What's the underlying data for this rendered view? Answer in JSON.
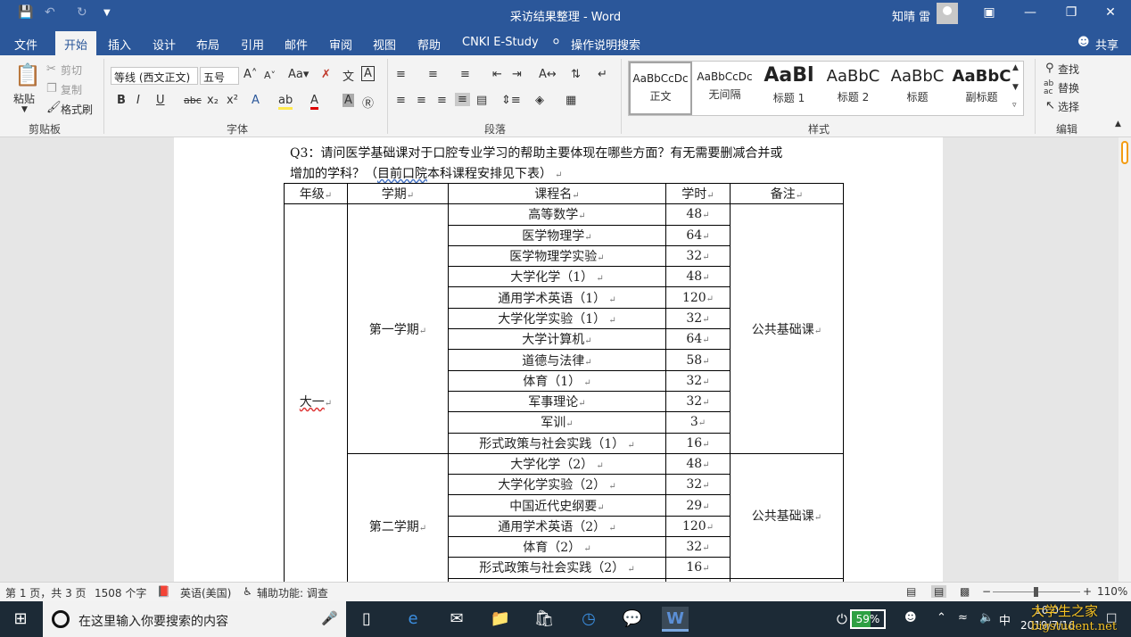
{
  "titlebar": {
    "title": "采访结果整理  -  Word",
    "user": "知晴 雷",
    "save_icon": "save-icon",
    "undo_icon": "undo-icon",
    "redo_icon": "redo-icon",
    "customize_icon": "customize-icon"
  },
  "tabs": [
    "文件",
    "开始",
    "插入",
    "设计",
    "布局",
    "引用",
    "邮件",
    "审阅",
    "视图",
    "帮助",
    "CNKI E-Study"
  ],
  "tell_me": "操作说明搜索",
  "share": "共享",
  "ribbon": {
    "clipboard": {
      "paste": "粘贴",
      "cut": "剪切",
      "copy": "复制",
      "format_painter": "格式刷",
      "label": "剪贴板"
    },
    "font": {
      "font_name": "等线 (西文正文)",
      "font_size": "五号",
      "label": "字体"
    },
    "paragraph": {
      "label": "段落"
    },
    "styles": {
      "label": "样式",
      "items": [
        {
          "preview": "AaBbCcDc",
          "name": "正文"
        },
        {
          "preview": "AaBbCcDc",
          "name": "无间隔"
        },
        {
          "preview": "AaBl",
          "name": "标题 1"
        },
        {
          "preview": "AaBbC",
          "name": "标题 2"
        },
        {
          "preview": "AaBbC",
          "name": "标题"
        },
        {
          "preview": "AaBbC",
          "name": "副标题"
        }
      ]
    },
    "editing": {
      "find": "查找",
      "replace": "替换",
      "select": "选择",
      "label": "编辑"
    }
  },
  "document": {
    "question_line1": "Q3：请问医学基础课对于口腔专业学习的帮助主要体现在哪些方面？有无需要删减合并或",
    "question_line2_a": "增加的学科？（",
    "question_line2_b": "目前口院",
    "question_line2_c": "本科课程安排见下表）",
    "table": {
      "headers": [
        "年级",
        "学期",
        "课程名",
        "学时",
        "备注"
      ],
      "grade": "大一",
      "semester1": {
        "name": "第一学期",
        "note": "公共基础课",
        "courses": [
          {
            "name": "高等数学",
            "hours": "48"
          },
          {
            "name": "医学物理学",
            "hours": "64"
          },
          {
            "name": "医学物理学实验",
            "hours": "32"
          },
          {
            "name": "大学化学（1）",
            "hours": "48"
          },
          {
            "name": "通用学术英语（1）",
            "hours": "120"
          },
          {
            "name": "大学化学实验（1）",
            "hours": "32"
          },
          {
            "name": "大学计算机",
            "hours": "64"
          },
          {
            "name": "道德与法律",
            "hours": "58"
          },
          {
            "name": "体育（1）",
            "hours": "32"
          },
          {
            "name": "军事理论",
            "hours": "32"
          },
          {
            "name": "军训",
            "hours": "3"
          },
          {
            "name": "形式政策与社会实践（1）",
            "hours": "16"
          }
        ]
      },
      "semester2": {
        "name": "第二学期",
        "note": "公共基础课",
        "courses": [
          {
            "name": "大学化学（2）",
            "hours": "48"
          },
          {
            "name": "大学化学实验（2）",
            "hours": "32"
          },
          {
            "name": "中国近代史纲要",
            "hours": "29"
          },
          {
            "name": "通用学术英语（2）",
            "hours": "120"
          },
          {
            "name": "体育（2）",
            "hours": "32"
          },
          {
            "name": "形式政策与社会实践（2）",
            "hours": "16"
          }
        ]
      }
    }
  },
  "statusbar": {
    "page": "第 1 页，共 3 页",
    "words": "1508 个字",
    "language": "英语(美国)",
    "accessibility": "辅助功能: 调查",
    "zoom": "110%"
  },
  "taskbar": {
    "search_placeholder": "在这里输入你要搜索的内容",
    "battery": "59%",
    "battery_level": 0.59,
    "ime": "中",
    "time": "16:0",
    "date": "2019/7/16"
  },
  "watermark": {
    "line1": "大学生之家",
    "line2": "bigstudent.net"
  },
  "colors": {
    "accent": "#2b579a",
    "highlight": "#ffe94d",
    "taskbar": "#1c2a36"
  }
}
